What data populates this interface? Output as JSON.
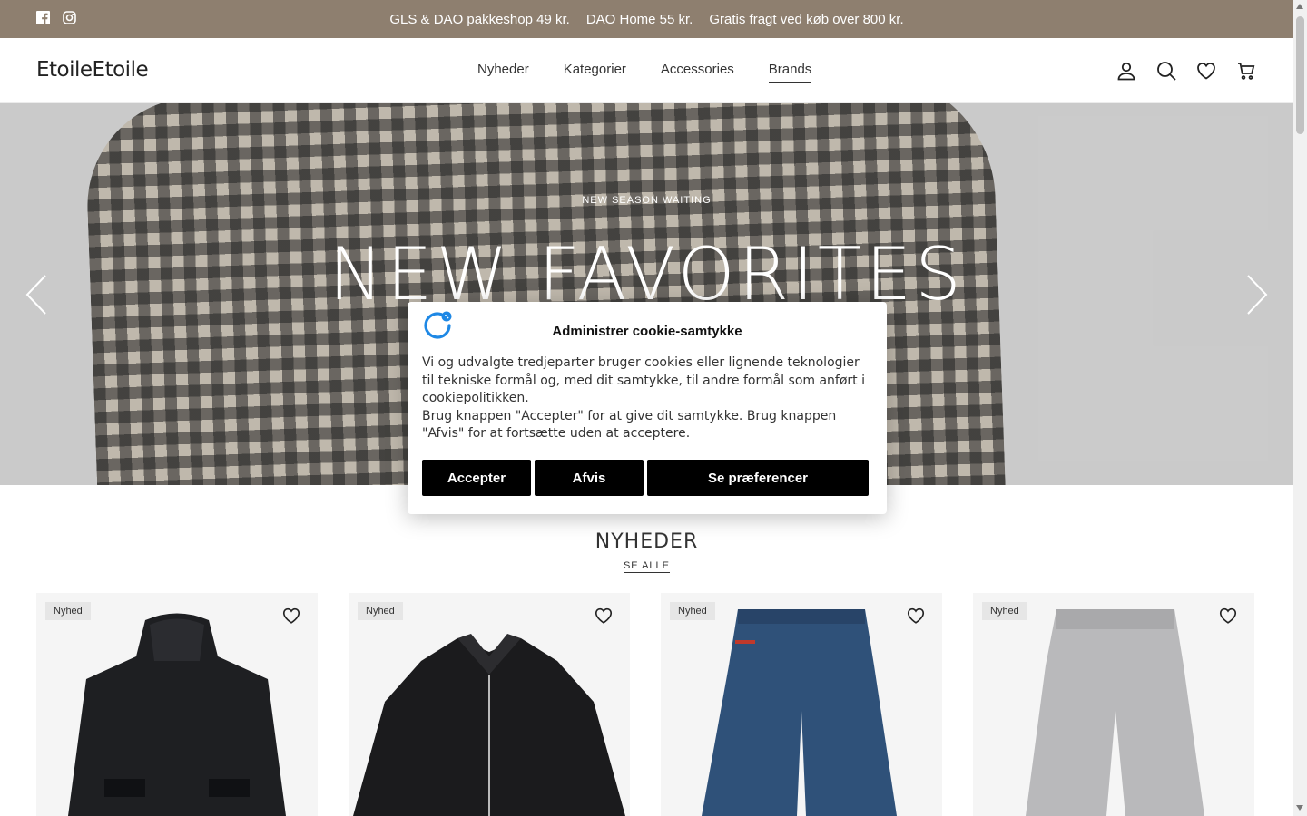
{
  "announcement": {
    "messages": [
      "GLS & DAO pakkeshop 49 kr.",
      "DAO Home 55 kr.",
      "Gratis fragt ved køb over 800 kr."
    ],
    "social_icons": [
      "facebook-icon",
      "instagram-icon"
    ]
  },
  "header": {
    "logo": "EtoileEtoile",
    "nav": [
      "Nyheder",
      "Kategorier",
      "Accessories",
      "Brands"
    ],
    "active_nav": "Brands",
    "icons": [
      "account-icon",
      "search-icon",
      "wishlist-heart-icon",
      "cart-icon"
    ]
  },
  "hero": {
    "kicker": "NEW SEASON WAITING",
    "headline": "NEW FAVORITES"
  },
  "section": {
    "title": "NYHEDER",
    "see_all": "SE ALLE"
  },
  "products": [
    {
      "badge": "Nyhed",
      "image": "black hooded jacket"
    },
    {
      "badge": "Nyhed",
      "image": "black zip jacket with collar"
    },
    {
      "badge": "Nyhed",
      "image": "blue wide jeans"
    },
    {
      "badge": "Nyhed",
      "image": "grey sweatpants"
    }
  ],
  "cookie": {
    "title": "Administrer cookie-samtykke",
    "body_1": "Vi og udvalgte tredjeparter bruger cookies eller lignende teknologier til tekniske formål og, med dit samtykke, til andre formål som anført i ",
    "policy_link": "cookiepolitikken",
    "body_1_end": ".",
    "body_2": "Brug knappen \"Accepter\" for at give dit samtykke. Brug knappen \"Afvis\" for at fortsætte uden at acceptere.",
    "accept": "Accepter",
    "reject": "Afvis",
    "preferences": "Se præferencer"
  },
  "colors": {
    "announcement_bg": "#8e7f6f",
    "button_bg": "#000000",
    "cookie_logo": "#1e88e5"
  }
}
